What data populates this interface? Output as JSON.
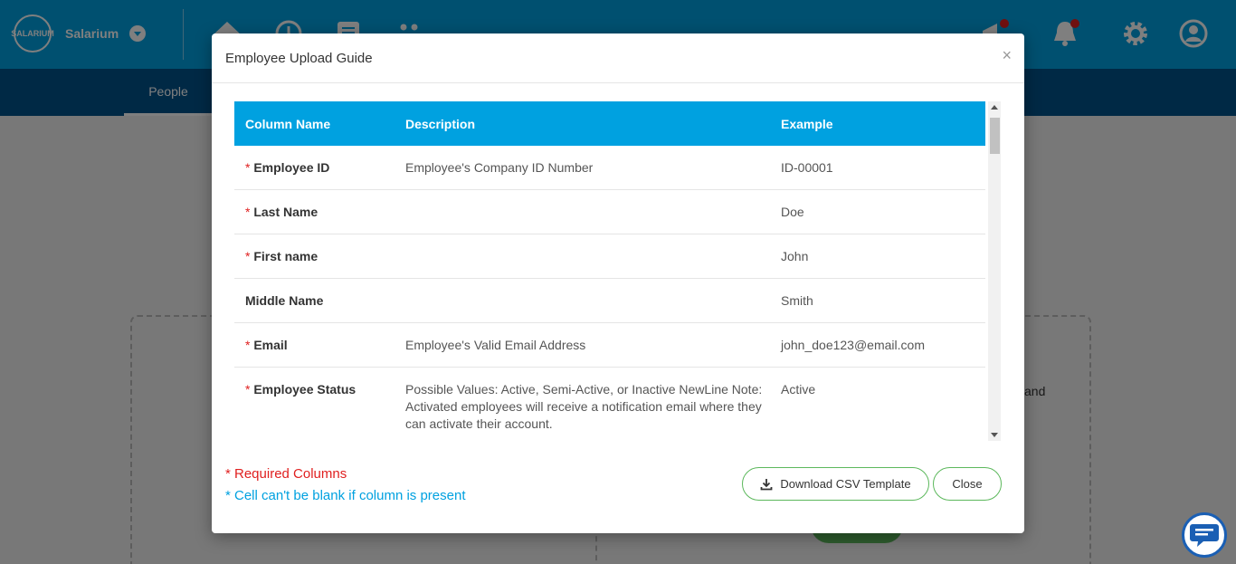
{
  "app": {
    "brand": "Salarium",
    "logo_text": "SALARIUM",
    "active_tab": "People",
    "background_text": "and"
  },
  "modal": {
    "title": "Employee Upload Guide",
    "close_symbol": "×",
    "columns": [
      "Column Name",
      "Description",
      "Example"
    ],
    "rows": [
      {
        "required": true,
        "name": "Employee ID",
        "description": "Employee's Company ID Number",
        "example": "ID-00001"
      },
      {
        "required": true,
        "name": "Last Name",
        "description": "",
        "example": "Doe"
      },
      {
        "required": true,
        "name": "First name",
        "description": "",
        "example": "John"
      },
      {
        "required": false,
        "name": "Middle Name",
        "description": "",
        "example": "Smith"
      },
      {
        "required": true,
        "name": "Email",
        "description": "Employee's Valid Email Address",
        "example": "john_doe123@email.com"
      },
      {
        "required": true,
        "name": "Employee Status",
        "description": "Possible Values: Active, Semi-Active, or Inactive NewLine Note: Activated employees will receive a notification email where they can activate their account.",
        "example": "Active"
      }
    ],
    "legend_required": "* Required Columns",
    "legend_not_blank": "* Cell can't be blank if column is present",
    "download_button": "Download CSV Template",
    "close_button": "Close"
  },
  "colors": {
    "primary": "#00a1e0",
    "header_dark": "#00528a",
    "required_red": "#e02020",
    "button_border": "#5cb85c"
  },
  "icons": [
    "home-icon",
    "clock-icon",
    "document-icon",
    "apps-icon",
    "megaphone-icon",
    "bell-icon",
    "gear-icon",
    "user-icon",
    "download-icon",
    "chat-icon"
  ]
}
